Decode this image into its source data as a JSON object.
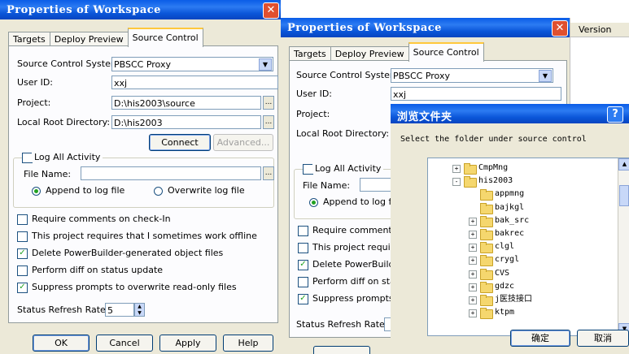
{
  "win1": {
    "title": "Properties of Workspace",
    "close": "✕",
    "tabs": [
      "Targets",
      "Deploy Preview",
      "Source Control"
    ],
    "scs_label": "Source Control System:",
    "scs_value": "PBSCC Proxy",
    "user_label": "User ID:",
    "user_value": "xxj",
    "project_label": "Project:",
    "project_value": "D:\\his2003\\source",
    "root_label": "Local Root Directory:",
    "root_value": "D:\\his2003",
    "connect": "Connect",
    "advanced": "Advanced...",
    "log_all": "Log All Activity",
    "file_name": "File Name:",
    "append": "Append to log file",
    "overwrite": "Overwrite log file",
    "options": [
      {
        "label": "Require comments on check-In",
        "checked": false
      },
      {
        "label": "This project requires that I sometimes work offline",
        "checked": false
      },
      {
        "label": "Delete PowerBuilder-generated object files",
        "checked": true
      },
      {
        "label": "Perform diff on status update",
        "checked": false
      },
      {
        "label": "Suppress prompts to overwrite read-only files",
        "checked": true
      }
    ],
    "refresh_label": "Status Refresh Rate:",
    "refresh_value": "5",
    "buttons": [
      "OK",
      "Cancel",
      "Apply",
      "Help"
    ]
  },
  "win2": {
    "title": "Properties of Workspace",
    "close": "✕",
    "tabs": [
      "Targets",
      "Deploy Preview",
      "Source Control"
    ],
    "scs_label": "Source Control System:",
    "scs_value": "PBSCC Proxy",
    "user_label": "User ID:",
    "user_value": "xxj",
    "project_label": "Project:",
    "root_label": "Local Root Directory:",
    "log_all": "Log All Activity",
    "file_name": "File Name:",
    "append": "Append to log file",
    "options": [
      {
        "label": "Require comments",
        "checked": false
      },
      {
        "label": "This project require",
        "checked": false
      },
      {
        "label": "Delete PowerBuilde",
        "checked": true
      },
      {
        "label": "Perform diff on stat",
        "checked": false
      },
      {
        "label": "Suppress prompts t",
        "checked": true
      }
    ],
    "refresh_label": "Status Refresh Rate:"
  },
  "back_column": {
    "header": "Version"
  },
  "browse": {
    "title": "浏览文件夹",
    "help": "?",
    "prompt": "Select the folder under source control",
    "tree": [
      {
        "label": "CmpMng",
        "level": 0,
        "expander": "+"
      },
      {
        "label": "his2003",
        "level": 0,
        "expander": "-"
      },
      {
        "label": "appmng",
        "level": 1,
        "expander": ""
      },
      {
        "label": "bajkgl",
        "level": 1,
        "expander": ""
      },
      {
        "label": "bak_src",
        "level": 1,
        "expander": "+"
      },
      {
        "label": "bakrec",
        "level": 1,
        "expander": "+"
      },
      {
        "label": "clgl",
        "level": 1,
        "expander": "+"
      },
      {
        "label": "crygl",
        "level": 1,
        "expander": "+"
      },
      {
        "label": "CVS",
        "level": 1,
        "expander": "+"
      },
      {
        "label": "gdzc",
        "level": 1,
        "expander": "+"
      },
      {
        "label": "j医技接口",
        "level": 1,
        "expander": "+"
      },
      {
        "label": "ktpm",
        "level": 1,
        "expander": "+"
      }
    ],
    "ok": "确定",
    "cancel": "取消"
  }
}
